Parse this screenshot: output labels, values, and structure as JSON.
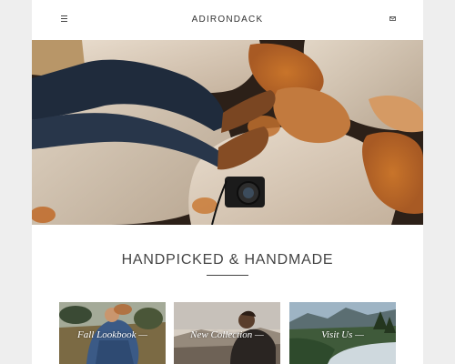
{
  "header": {
    "brand": "ADIRONDACK",
    "menu_icon": "hamburger-menu-icon",
    "mail_icon": "mail-icon"
  },
  "hero": {
    "image": "photo of person in jeans and brown boots lying on boulders with a camera"
  },
  "section": {
    "heading": "HANDPICKED & HANDMADE"
  },
  "cards": [
    {
      "label": "Fall Lookbook —"
    },
    {
      "label": "New Collection —"
    },
    {
      "label": "Visit Us —"
    }
  ],
  "colors": {
    "background": "#eeeeee",
    "page": "#ffffff",
    "text": "#444444"
  }
}
